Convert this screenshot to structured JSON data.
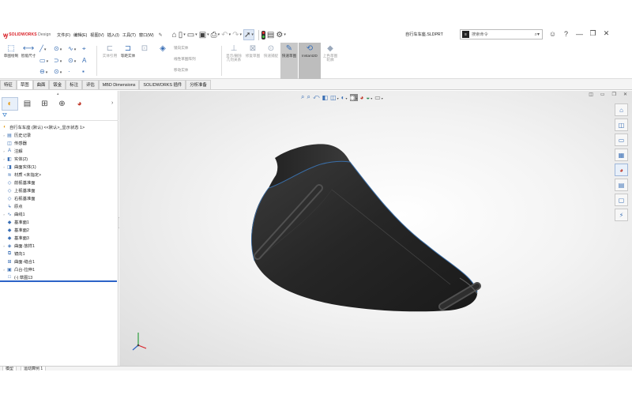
{
  "app": {
    "brand": "SOLIDWORKS",
    "brand_suffix": " Design",
    "doc_title": "自行车车座.SLDPRT"
  },
  "menu": [
    "文件(F)",
    "编辑(E)",
    "视图(V)",
    "插入(I)",
    "工具(T)",
    "窗口(W)"
  ],
  "search": {
    "placeholder": "搜索命令"
  },
  "command_manager": {
    "sketch": "草图绘制",
    "smart_dim": "智能尺寸",
    "entity": "实体引用",
    "offset": "等距实体",
    "convert": "转换实体引用",
    "move_entity": "移动实体",
    "linear_pattern": "线性草图阵列",
    "mirror": "镜向实体",
    "display_delete": "显示/删除几何关系",
    "repair": "修复草图",
    "quick_snap": "快速捕捉",
    "quick_sketch": "快速草图",
    "instant2d": "Instant2D",
    "shaded_sketch": "上色草图轮廓"
  },
  "tabs": [
    "特征",
    "草图",
    "曲面",
    "钣金",
    "标注",
    "评估",
    "MBD Dimensions",
    "SOLIDWORKS 插件",
    "分析准备"
  ],
  "tree": {
    "root": "自行车车座 (默认) <<默认>_显示状态 1>",
    "items": [
      {
        "label": "历史记录",
        "exp": "›",
        "icon": "▤"
      },
      {
        "label": "传感器",
        "exp": "",
        "icon": "◫"
      },
      {
        "label": "注解",
        "exp": "›",
        "icon": "A"
      },
      {
        "label": "实体(2)",
        "exp": "›",
        "icon": "◧"
      },
      {
        "label": "曲面实体(1)",
        "exp": "›",
        "icon": "◨"
      },
      {
        "label": "材质 <未指定>",
        "exp": "",
        "icon": "≋"
      },
      {
        "label": "前视基准面",
        "exp": "",
        "icon": "◇"
      },
      {
        "label": "上视基准面",
        "exp": "",
        "icon": "◇"
      },
      {
        "label": "右视基准面",
        "exp": "",
        "icon": "◇"
      },
      {
        "label": "原点",
        "exp": "",
        "icon": "↳"
      },
      {
        "label": "曲线1",
        "exp": "›",
        "icon": "∿"
      },
      {
        "label": "基准面1",
        "exp": "",
        "icon": "◆"
      },
      {
        "label": "基准面2",
        "exp": "",
        "icon": "◆"
      },
      {
        "label": "基准面3",
        "exp": "",
        "icon": "◆"
      },
      {
        "label": "曲面-放样1",
        "exp": "›",
        "icon": "◈"
      },
      {
        "label": "镜向1",
        "exp": "",
        "icon": "⧉"
      },
      {
        "label": "曲面-缝合1",
        "exp": "",
        "icon": "⊞"
      },
      {
        "label": "凸台-拉伸1",
        "exp": "›",
        "icon": "▣"
      },
      {
        "label": "(-) 草图13",
        "exp": "",
        "icon": "□"
      }
    ]
  },
  "bottom_tabs": [
    "模型",
    "运动算例 1"
  ],
  "colors": {
    "accent": "#2b63c7",
    "brand": "#d92027",
    "model": "#2a2a2a"
  }
}
